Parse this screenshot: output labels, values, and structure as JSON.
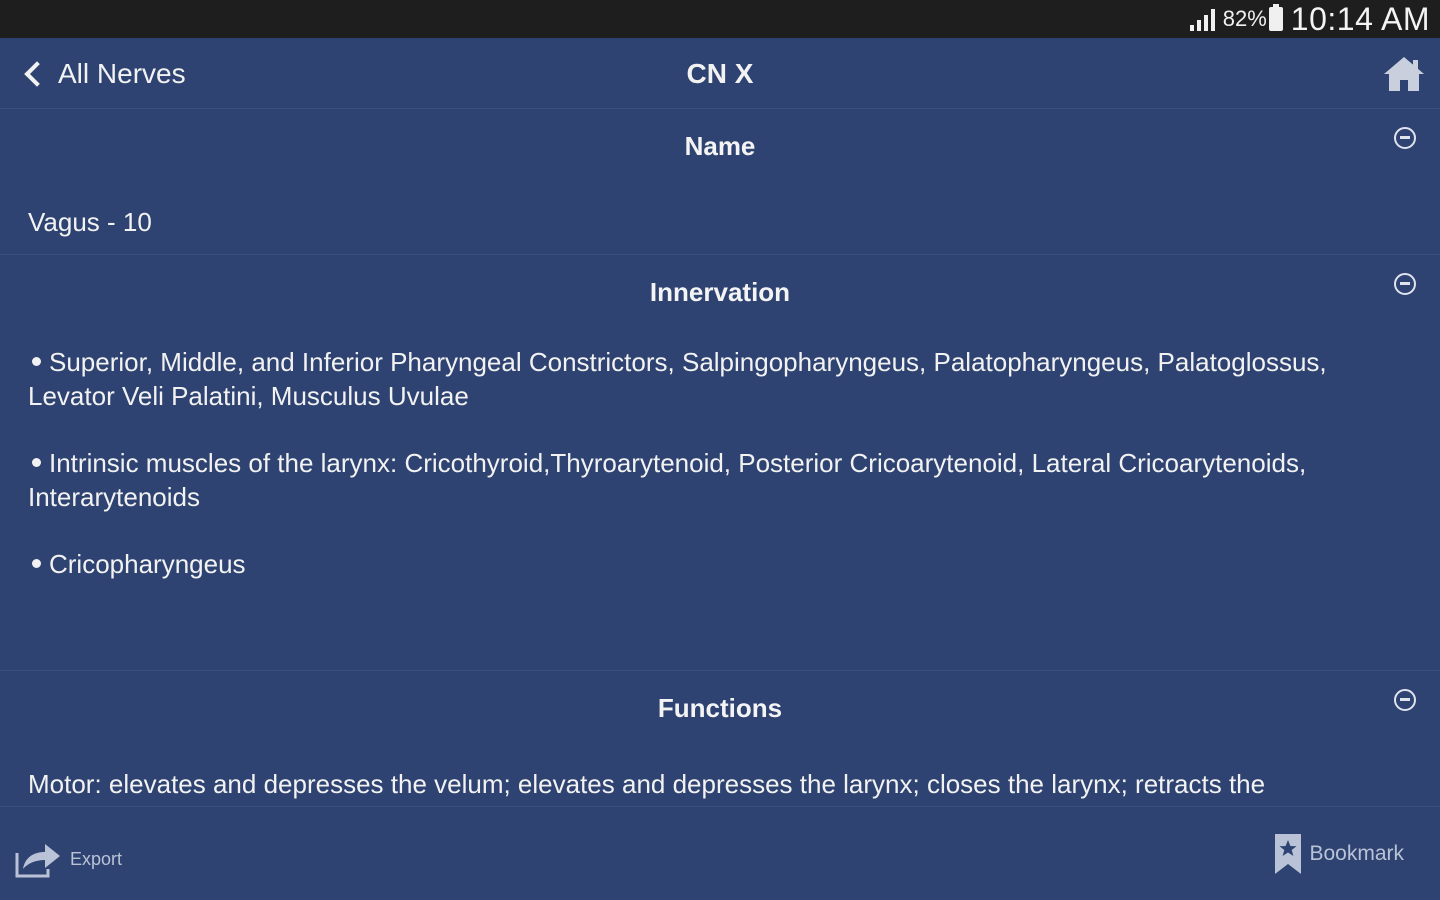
{
  "status_bar": {
    "battery": "82%",
    "time": "10:14 AM"
  },
  "nav": {
    "back_label": "All Nerves",
    "title": "CN X"
  },
  "sections": {
    "name": {
      "title": "Name",
      "body": "Vagus - 10"
    },
    "innervation": {
      "title": "Innervation",
      "items": [
        "Superior, Middle, and Inferior Pharyngeal Constrictors, Salpingopharyngeus, Palatopharyngeus, Palatoglossus, Levator Veli Palatini, Musculus Uvulae",
        "Intrinsic muscles of the larynx: Cricothyroid,Thyroarytenoid, Posterior Cricoarytenoid, Lateral Cricoarytenoids, Interarytenoids",
        "Cricopharyngeus"
      ]
    },
    "functions": {
      "title": "Functions",
      "body": "Motor: elevates and depresses the velum; elevates and depresses the larynx; closes the larynx; retracts the"
    }
  },
  "bottom_bar": {
    "export_label": "Export",
    "bookmark_label": "Bookmark"
  },
  "colors": {
    "background": "#2e4371",
    "status_bar": "#1e1e1e",
    "text": "#f2f2f2",
    "muted": "#b9c2d6"
  }
}
